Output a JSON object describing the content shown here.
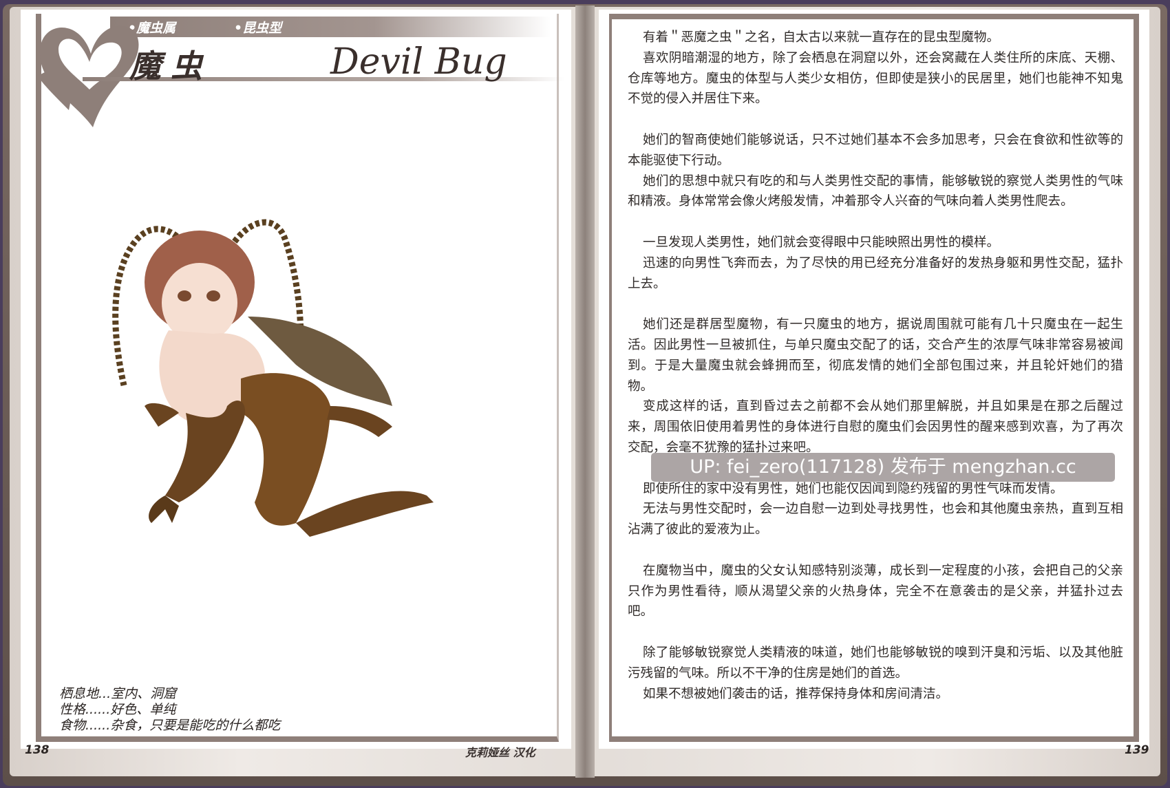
{
  "left_page": {
    "tags": [
      "•魔虫属",
      "•昆虫型"
    ],
    "title_cn": "魔虫",
    "title_en": "Devil Bug",
    "stats": [
      "栖息地...室内、洞窟",
      "性格......好色、单纯",
      "食物......杂食，只要是能吃的什么都吃"
    ],
    "page_number": "138",
    "credit": "克莉娅丝 汉化"
  },
  "right_page": {
    "paragraphs": [
      "有着＂恶魔之虫＂之名，自太古以来就一直存在的昆虫型魔物。",
      "喜欢阴暗潮湿的地方，除了会栖息在洞窟以外，还会窝藏在人类住所的床底、天棚、仓库等地方。魔虫的体型与人类少女相仿，但即使是狭小的民居里，她们也能神不知鬼不觉的侵入并居住下来。",
      "",
      "她们的智商使她们能够说话，只不过她们基本不会多加思考，只会在食欲和性欲等的本能驱使下行动。",
      "她们的思想中就只有吃的和与人类男性交配的事情，能够敏锐的察觉人类男性的气味和精液。身体常常会像火烤般发情，冲着那令人兴奋的气味向着人类男性爬去。",
      "",
      "一旦发现人类男性，她们就会变得眼中只能映照出男性的模样。",
      "迅速的向男性飞奔而去，为了尽快的用已经充分准备好的发热身躯和男性交配，猛扑上去。",
      "",
      "她们还是群居型魔物，有一只魔虫的地方，据说周围就可能有几十只魔虫在一起生活。因此男性一旦被抓住，与单只魔虫交配了的话，交合产生的浓厚气味非常容易被闻到。于是大量魔虫就会蜂拥而至，彻底发情的她们全部包围过来，并且轮奸她们的猎物。",
      "变成这样的话，直到昏过去之前都不会从她们那里解脱，并且如果是在那之后醒过来，周围依旧使用着男性的身体进行自慰的魔虫们会因男性的醒来感到欢喜，为了再次交配，会毫不犹豫的猛扑过来吧。",
      "",
      "即使所住的家中没有男性，她们也能仅因闻到隐约残留的男性气味而发情。",
      "无法与男性交配时，会一边自慰一边到处寻找男性，也会和其他魔虫亲热，直到互相沾满了彼此的爱液为止。",
      "",
      "在魔物当中，魔虫的父女认知感特别淡薄，成长到一定程度的小孩，会把自己的父亲只作为男性看待，顺从渴望父亲的火热身体，完全不在意袭击的是父亲，并猛扑过去吧。",
      "",
      "除了能够敏锐察觉人类精液的味道，她们也能够敏锐的嗅到汗臭和污垢、以及其他脏污残留的气味。所以不干净的住房是她们的首选。",
      "如果不想被她们袭击的话，推荐保持身体和房间清洁。"
    ],
    "page_number": "139",
    "watermark": "UP: fei_zero(117128) 发布于 mengzhan.cc"
  },
  "colors": {
    "frame": "#8e7f79",
    "cover": "#6b5c56",
    "text": "#2f2a28"
  }
}
